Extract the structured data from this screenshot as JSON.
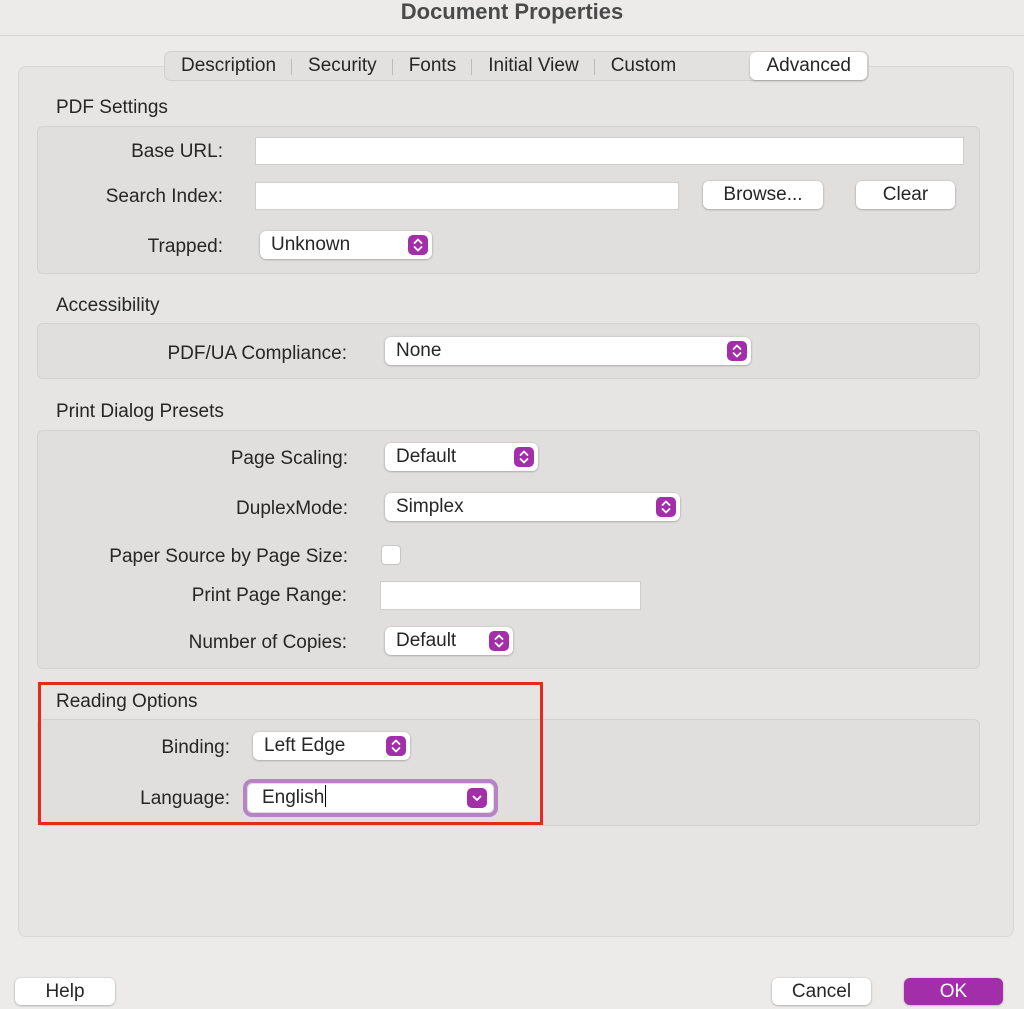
{
  "window": {
    "title": "Document Properties"
  },
  "tabs": [
    "Description",
    "Security",
    "Fonts",
    "Initial View",
    "Custom",
    "Advanced"
  ],
  "active_tab": "Advanced",
  "pdf_settings": {
    "title": "PDF Settings",
    "base_url_label": "Base URL:",
    "base_url_value": "",
    "search_index_label": "Search Index:",
    "search_index_value": "",
    "browse_label": "Browse...",
    "clear_label": "Clear",
    "trapped_label": "Trapped:",
    "trapped_value": "Unknown"
  },
  "accessibility": {
    "title": "Accessibility",
    "pdfua_label": "PDF/UA Compliance:",
    "pdfua_value": "None"
  },
  "print_presets": {
    "title": "Print Dialog Presets",
    "page_scaling_label": "Page Scaling:",
    "page_scaling_value": "Default",
    "duplex_label": "DuplexMode:",
    "duplex_value": "Simplex",
    "paper_source_label": "Paper Source by Page Size:",
    "paper_source_checked": false,
    "print_range_label": "Print Page Range:",
    "print_range_value": "",
    "copies_label": "Number of Copies:",
    "copies_value": "Default"
  },
  "reading_options": {
    "title": "Reading Options",
    "binding_label": "Binding:",
    "binding_value": "Left Edge",
    "language_label": "Language:",
    "language_value": "English"
  },
  "footer": {
    "help_label": "Help",
    "cancel_label": "Cancel",
    "ok_label": "OK"
  },
  "colors": {
    "accent": "#a22fa9",
    "highlight_box": "#e8281c",
    "focus_ring": "#b683c3"
  }
}
